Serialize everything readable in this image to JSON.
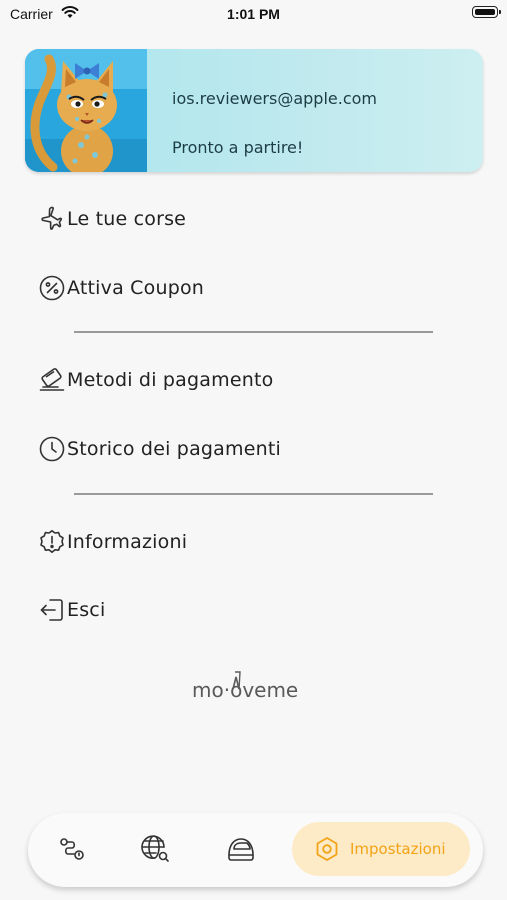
{
  "status_bar": {
    "carrier": "Carrier",
    "time": "1:01 PM"
  },
  "profile": {
    "email": "ios.reviewers@apple.com",
    "status": "Pronto a partire!"
  },
  "menu": {
    "rides": "Le tue corse",
    "coupon": "Attiva Coupon",
    "payment_methods": "Metodi di pagamento",
    "payment_history": "Storico dei pagamenti",
    "info": "Informazioni",
    "logout": "Esci"
  },
  "brand": {
    "logo_text": "mo·oveme"
  },
  "tabbar": {
    "active_label": "Impostazioni",
    "active_color": "#f2a316",
    "active_bg": "#fdebc8"
  },
  "icons": {
    "rides": "plane-icon",
    "coupon": "percent-coupon-icon",
    "payment_methods": "card-pay-icon",
    "payment_history": "clock-icon",
    "info": "info-badge-icon",
    "logout": "logout-icon",
    "tab1": "route-icon",
    "tab2": "globe-search-icon",
    "tab3": "helmet-icon",
    "tab4": "settings-hex-icon"
  }
}
